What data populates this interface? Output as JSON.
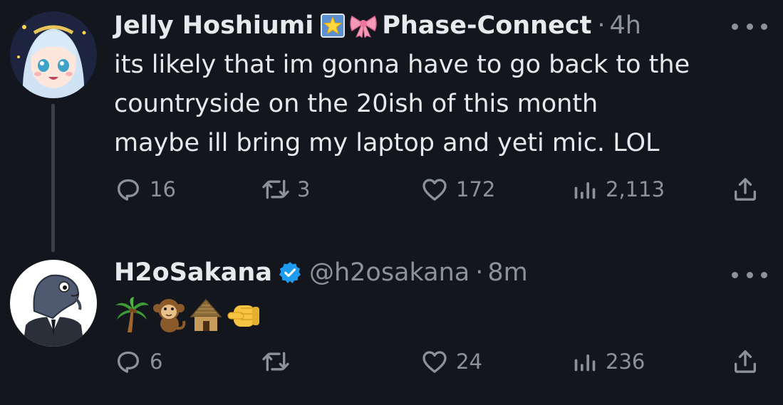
{
  "tweets": [
    {
      "display_name": "Jelly Hoshiumi",
      "affiliation": "Phase-Connect",
      "separator": "·",
      "time": "4h",
      "text_lines": [
        "its likely that im gonna have to go back to the",
        "countryside on the 20ish of this month",
        "maybe ill bring my laptop and yeti mic. LOL"
      ],
      "replies": "16",
      "retweets": "3",
      "likes": "172",
      "views": "2,113",
      "avatar_icon": "anime-girl-avatar",
      "badges": [
        "star-org-badge-icon",
        "pink-bow-badge-icon"
      ]
    },
    {
      "display_name": "H2oSakana",
      "handle": "@h2osakana",
      "separator": "·",
      "time": "8m",
      "emojis": [
        "palm-tree-emoji",
        "monkey-emoji",
        "hut-emoji",
        "pointing-fist-emoji"
      ],
      "replies": "6",
      "retweets": "",
      "likes": "24",
      "views": "236",
      "avatar_icon": "fish-in-suit-avatar",
      "badges": [
        "verified-badge-icon"
      ]
    }
  ],
  "colors": {
    "background": "#14161e",
    "text": "#e7e9ea",
    "muted": "#8b9299",
    "verified": "#1d9bf0",
    "thread_line": "#3a3f46"
  }
}
